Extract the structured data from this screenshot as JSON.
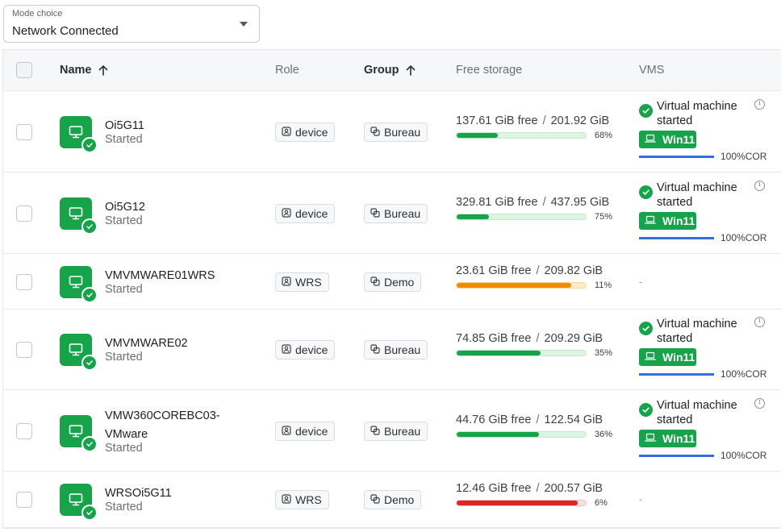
{
  "mode": {
    "label": "Mode choice",
    "value": "Network Connected"
  },
  "columns": {
    "name": "Name",
    "role": "Role",
    "group": "Group",
    "storage": "Free storage",
    "vms": "VMS"
  },
  "colors": {
    "green": "#16a34a",
    "orange": "#f08c00",
    "red": "#dc2626",
    "blue": "#2f6fe0"
  },
  "rows": [
    {
      "name": "Oi5G11",
      "status": "Started",
      "role": "device",
      "group": "Bureau",
      "free": "137.61 GiB free",
      "total": "201.92 GiB",
      "pct": "68%",
      "used_fraction": 0.32,
      "bar_color": "#16a34a",
      "vm": {
        "status": "Virtual machine started",
        "name": "Win11",
        "usage": "100%COR"
      }
    },
    {
      "name": "Oi5G12",
      "status": "Started",
      "role": "device",
      "group": "Bureau",
      "free": "329.81 GiB free",
      "total": "437.95 GiB",
      "pct": "75%",
      "used_fraction": 0.25,
      "bar_color": "#16a34a",
      "vm": {
        "status": "Virtual machine started",
        "name": "Win11",
        "usage": "100%COR"
      }
    },
    {
      "name": "VMVMWARE01WRS",
      "status": "Started",
      "role": "WRS",
      "group": "Demo",
      "free": "23.61 GiB free",
      "total": "209.82 GiB",
      "pct": "11%",
      "used_fraction": 0.89,
      "bar_color": "#f08c00",
      "vm": null,
      "dash": "-"
    },
    {
      "name": "VMVMWARE02",
      "status": "Started",
      "role": "device",
      "group": "Bureau",
      "free": "74.85 GiB free",
      "total": "209.29 GiB",
      "pct": "35%",
      "used_fraction": 0.65,
      "bar_color": "#16a34a",
      "vm": {
        "status": "Virtual machine started",
        "name": "Win11",
        "usage": "100%COR"
      }
    },
    {
      "name": "VMW360COREBC03-VMware",
      "status": "Started",
      "role": "device",
      "group": "Bureau",
      "free": "44.76 GiB free",
      "total": "122.54 GiB",
      "pct": "36%",
      "used_fraction": 0.64,
      "bar_color": "#16a34a",
      "vm": {
        "status": "Virtual machine started",
        "name": "Win11",
        "usage": "100%COR"
      }
    },
    {
      "name": "WRSOi5G11",
      "status": "Started",
      "role": "WRS",
      "group": "Demo",
      "free": "12.46 GiB free",
      "total": "200.57 GiB",
      "pct": "6%",
      "used_fraction": 0.94,
      "bar_color": "#dc2626",
      "vm": null,
      "dash": "-"
    }
  ]
}
